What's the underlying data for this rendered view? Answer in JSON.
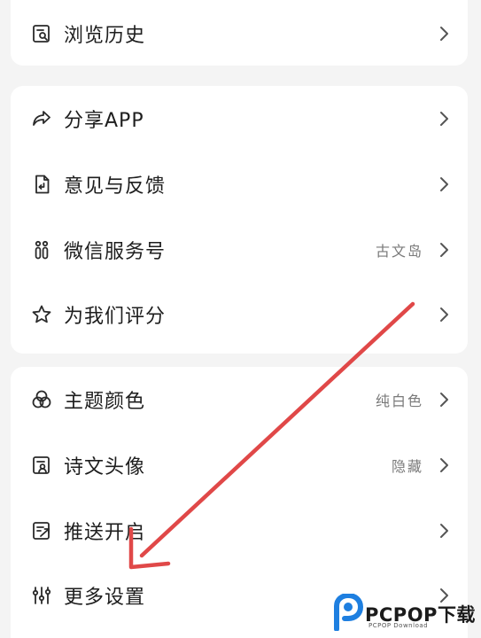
{
  "colors": {
    "background": "#f4f4f4",
    "card": "#ffffff",
    "text": "#1e1e1e",
    "secondary_text": "#7a7a7a",
    "chevron": "#555555",
    "annotation_arrow": "#e04848",
    "watermark_blue": "#1e7fe0"
  },
  "groups": [
    {
      "items": [
        {
          "icon": "history-icon",
          "label": "浏览历史",
          "value": ""
        }
      ]
    },
    {
      "items": [
        {
          "icon": "share-icon",
          "label": "分享APP",
          "value": ""
        },
        {
          "icon": "feedback-icon",
          "label": "意见与反馈",
          "value": ""
        },
        {
          "icon": "wechat-service-icon",
          "label": "微信服务号",
          "value": "古文岛"
        },
        {
          "icon": "star-icon",
          "label": "为我们评分",
          "value": ""
        }
      ]
    },
    {
      "items": [
        {
          "icon": "theme-color-icon",
          "label": "主题颜色",
          "value": "纯白色"
        },
        {
          "icon": "poem-avatar-icon",
          "label": "诗文头像",
          "value": "隐藏"
        },
        {
          "icon": "push-icon",
          "label": "推送开启",
          "value": ""
        },
        {
          "icon": "sliders-icon",
          "label": "更多设置",
          "value": ""
        }
      ]
    }
  ],
  "watermark": {
    "brand": "PCPOP",
    "brand_cn": "下载",
    "sub": "PCPOP Download"
  }
}
